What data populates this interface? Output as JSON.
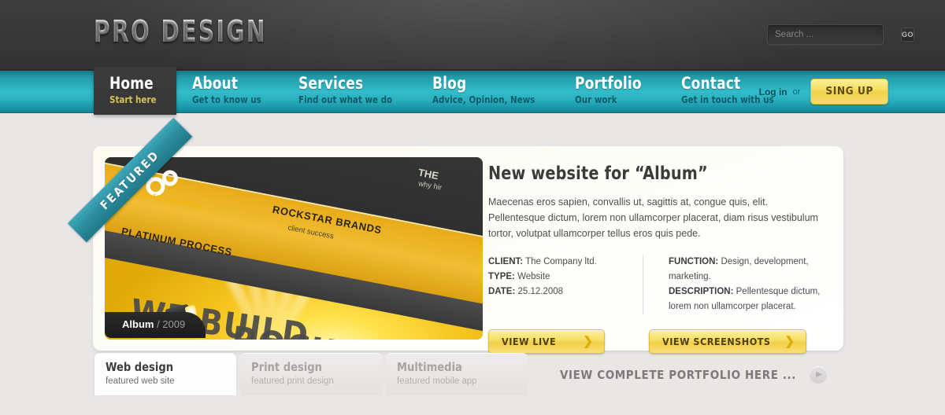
{
  "header": {
    "logo": "PRO DESIGN",
    "search": {
      "placeholder": "Search ...",
      "value": "",
      "go_label": "GO"
    }
  },
  "nav": {
    "items": [
      {
        "label": "Home",
        "sub": "Start here",
        "active": true
      },
      {
        "label": "About",
        "sub": "Get to know us",
        "active": false
      },
      {
        "label": "Services",
        "sub": "Find out what we do",
        "active": false
      },
      {
        "label": "Blog",
        "sub": "Advice, Opinion, News",
        "active": false
      },
      {
        "label": "Portfolio",
        "sub": "Our work",
        "active": false
      },
      {
        "label": "Contact",
        "sub": "Get in touch with us",
        "active": false
      }
    ],
    "auth": {
      "login_label": "Log in",
      "or_label": "or",
      "signup_label": "SING UP"
    }
  },
  "featured": {
    "ribbon_label": "FEATURED",
    "caption_name": "Album",
    "caption_year": "/ 2009",
    "mockup": {
      "brand_tagline": "hi-fidelity marketing.",
      "panel1_title": "PLATINUM PROCESS",
      "panel1_sub": "how we do it",
      "panel2_title": "ROCKSTAR BRANDS",
      "panel2_sub": "client success",
      "panel3_title": "THE",
      "panel3_sub": "why hir",
      "headline_line1": "WE BUILD",
      "headline_line2": "ROCKSTAR"
    }
  },
  "details": {
    "title": "New website for “Album”",
    "body": "Maecenas eros sapien, convallis ut, sagittis at, congue quis, elit. Pellentesque dictum, lorem non ullamcorper placerat, diam risus vestibulum tortor, volutpat ullamcorper tellus eros quis pede.",
    "meta_left": [
      {
        "key": "CLIENT:",
        "value": "The Company ltd."
      },
      {
        "key": "TYPE:",
        "value": "Website"
      },
      {
        "key": "DATE:",
        "value": "25.12.2008"
      }
    ],
    "meta_right": [
      {
        "key": "FUNCTION:",
        "value": "Design, development, marketing."
      },
      {
        "key": "DESCRIPTION:",
        "value": "Pellentesque dictum, lorem non ullamcorper placerat."
      }
    ],
    "buttons": [
      {
        "label": "VIEW LIVE",
        "chevron": "❯"
      },
      {
        "label": "VIEW SCREENSHOTS",
        "chevron": "❯"
      }
    ]
  },
  "tabs": [
    {
      "title": "Web design",
      "sub": "featured web site",
      "active": true
    },
    {
      "title": "Print design",
      "sub": "featured print design",
      "active": false
    },
    {
      "title": "Multimedia",
      "sub": "featured mobile app",
      "active": false
    }
  ],
  "portfolio_link": {
    "label": "VIEW COMPLETE PORTFOLIO HERE ...",
    "arrow": "▶"
  },
  "colors": {
    "header_dark": "#3a3a3a",
    "nav_teal": "#33bcc9",
    "accent_yellow": "#f5dc63",
    "page_bg": "#e9e6e6",
    "ribbon_teal": "#2b8c9e"
  }
}
